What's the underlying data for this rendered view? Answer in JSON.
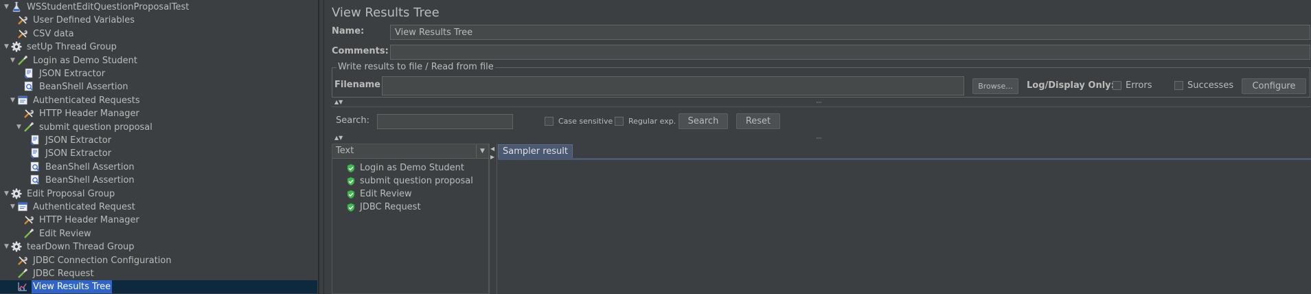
{
  "tree": {
    "items": [
      {
        "label": "WSStudentEditQuestionProposalTest",
        "icon": "flask-icon",
        "toggle": "▼"
      },
      {
        "label": "User Defined Variables",
        "icon": "wrench-icon",
        "toggle": ""
      },
      {
        "label": "CSV data",
        "icon": "wrench-icon",
        "toggle": ""
      },
      {
        "label": "setUp Thread Group",
        "icon": "gear-icon",
        "toggle": "▼"
      },
      {
        "label": "Login as Demo Student",
        "icon": "pipette-icon",
        "toggle": "▼"
      },
      {
        "label": "JSON Extractor",
        "icon": "extractor-icon",
        "toggle": ""
      },
      {
        "label": "BeanShell Assertion",
        "icon": "assertion-icon",
        "toggle": ""
      },
      {
        "label": "Authenticated Requests",
        "icon": "controller-icon",
        "toggle": "▼"
      },
      {
        "label": "HTTP Header Manager",
        "icon": "wrench-icon",
        "toggle": ""
      },
      {
        "label": "submit question proposal",
        "icon": "pipette-icon",
        "toggle": "▼"
      },
      {
        "label": "JSON Extractor",
        "icon": "extractor-icon",
        "toggle": ""
      },
      {
        "label": "JSON Extractor",
        "icon": "extractor-icon",
        "toggle": ""
      },
      {
        "label": "BeanShell Assertion",
        "icon": "assertion-icon",
        "toggle": ""
      },
      {
        "label": "BeanShell Assertion",
        "icon": "assertion-icon",
        "toggle": ""
      },
      {
        "label": "Edit Proposal Group",
        "icon": "gear-icon",
        "toggle": "▼"
      },
      {
        "label": "Authenticated Request",
        "icon": "controller-icon",
        "toggle": "▼"
      },
      {
        "label": "HTTP Header Manager",
        "icon": "wrench-icon",
        "toggle": ""
      },
      {
        "label": "Edit Review",
        "icon": "pipette-icon",
        "toggle": ""
      },
      {
        "label": "tearDown Thread Group",
        "icon": "gear-icon",
        "toggle": "▼"
      },
      {
        "label": "JDBC Connection Configuration",
        "icon": "wrench-icon",
        "toggle": ""
      },
      {
        "label": "JDBC Request",
        "icon": "pipette-icon",
        "toggle": ""
      },
      {
        "label": "View Results Tree",
        "icon": "chart-icon",
        "toggle": ""
      }
    ]
  },
  "panel": {
    "title": "View Results Tree",
    "name_label": "Name:",
    "name_value": "View Results Tree",
    "comments_label": "Comments:",
    "comments_value": "",
    "file_group_label": "Write results to file / Read from file",
    "filename_label": "Filename",
    "filename_value": "",
    "browse_label": "Browse...",
    "log_display_label": "Log/Display Only:",
    "errors_label": "Errors",
    "successes_label": "Successes",
    "configure_label": "Configure"
  },
  "search": {
    "label": "Search:",
    "value": "",
    "case_sensitive_label": "Case sensitive",
    "regex_label": "Regular exp.",
    "search_button": "Search",
    "reset_button": "Reset"
  },
  "results": {
    "renderer": "Text",
    "items": [
      "Login as Demo Student",
      "submit question proposal",
      "Edit Review",
      "JDBC Request"
    ],
    "tab_label": "Sampler result"
  },
  "colors": {
    "background": "#3c3f41",
    "selection": "#2f65ca",
    "success_green": "#3fb950",
    "tab_blue": "#4a5872"
  }
}
